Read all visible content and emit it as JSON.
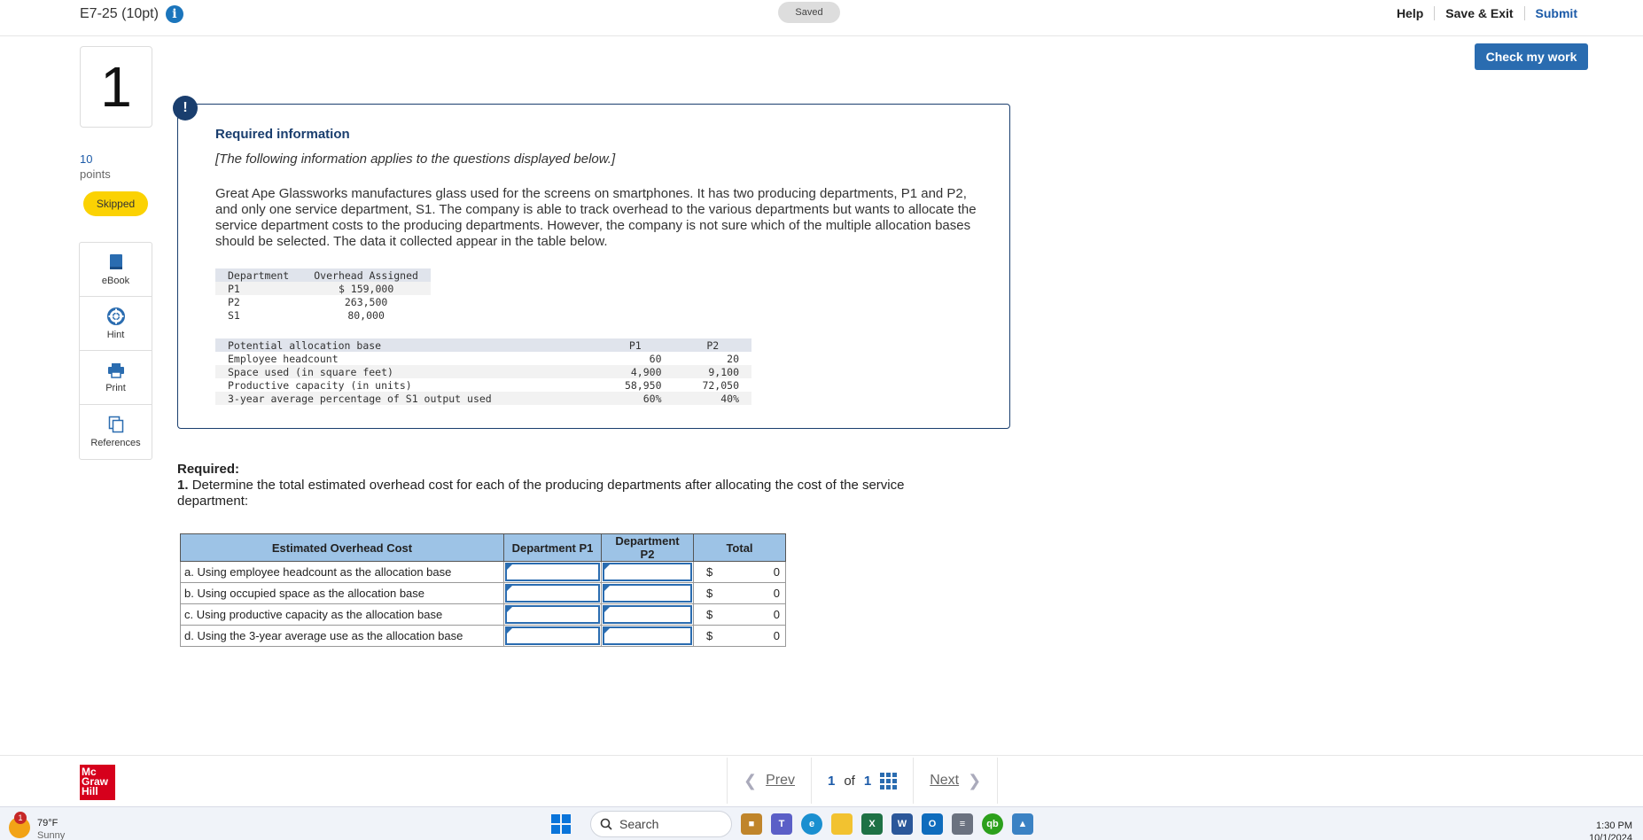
{
  "header": {
    "assignment_title": "E7-25 (10pt)",
    "saved_label": "Saved",
    "links": [
      "Help",
      "Save & Exit",
      "Submit"
    ],
    "check_button": "Check my work"
  },
  "question": {
    "number": "1",
    "points_value": "10",
    "points_label": "points",
    "status": "Skipped"
  },
  "tools": [
    {
      "label": "eBook",
      "icon": "book-icon"
    },
    {
      "label": "Hint",
      "icon": "lifebuoy-icon"
    },
    {
      "label": "Print",
      "icon": "printer-icon"
    },
    {
      "label": "References",
      "icon": "copy-icon"
    }
  ],
  "info": {
    "title": "Required information",
    "note": "[The following information applies to the questions displayed below.]",
    "paragraph": "Great Ape Glassworks manufactures glass used for the screens on smartphones. It has two producing departments, P1 and P2, and only one service department, S1. The company is able to track overhead to the various departments but wants to allocate the service department costs to the producing departments. However, the company is not sure which of the multiple allocation bases should be selected. The data it collected appear in the table below.",
    "table1": {
      "headers": [
        "Department",
        "Overhead Assigned"
      ],
      "rows": [
        [
          "P1",
          "$ 159,000"
        ],
        [
          "P2",
          "263,500"
        ],
        [
          "S1",
          "80,000"
        ]
      ]
    },
    "table2": {
      "headers": [
        "Potential allocation base",
        "P1",
        "P2"
      ],
      "rows": [
        [
          "Employee headcount",
          "60",
          "20"
        ],
        [
          "Space used (in square feet)",
          "4,900",
          "9,100"
        ],
        [
          "Productive capacity (in units)",
          "58,950",
          "72,050"
        ],
        [
          "3-year average percentage of S1 output used",
          "60%",
          "40%"
        ]
      ]
    }
  },
  "required": {
    "heading": "Required:",
    "number": "1.",
    "text": "Determine the total estimated overhead cost for each of the producing departments after allocating the cost of the service department:"
  },
  "answer_table": {
    "headers": [
      "Estimated Overhead Cost",
      "Department P1",
      "Department P2",
      "Total"
    ],
    "rows": [
      {
        "label": "a. Using employee headcount as the allocation base",
        "currency": "$",
        "total": "0"
      },
      {
        "label": "b. Using occupied space as the allocation base",
        "currency": "$",
        "total": "0"
      },
      {
        "label": "c. Using productive capacity as the allocation base",
        "currency": "$",
        "total": "0"
      },
      {
        "label": "d. Using the 3-year average use as the allocation base",
        "currency": "$",
        "total": "0"
      }
    ]
  },
  "footer": {
    "logo_lines": [
      "Mc",
      "Graw",
      "Hill"
    ],
    "prev": "Prev",
    "page_current": "1",
    "page_of": "of",
    "page_total": "1",
    "next": "Next"
  },
  "taskbar": {
    "temperature": "79°F",
    "weather": "Sunny",
    "weather_badge": "1",
    "search_placeholder": "Search",
    "time": "1:30 PM",
    "date": "10/1/2024"
  },
  "colors": {
    "accent": "#2a6cb0",
    "info_border": "#1a3e6e",
    "skipped_badge": "#fbd203",
    "table_header": "#9dc3e6",
    "brand_red": "#d6001c"
  }
}
